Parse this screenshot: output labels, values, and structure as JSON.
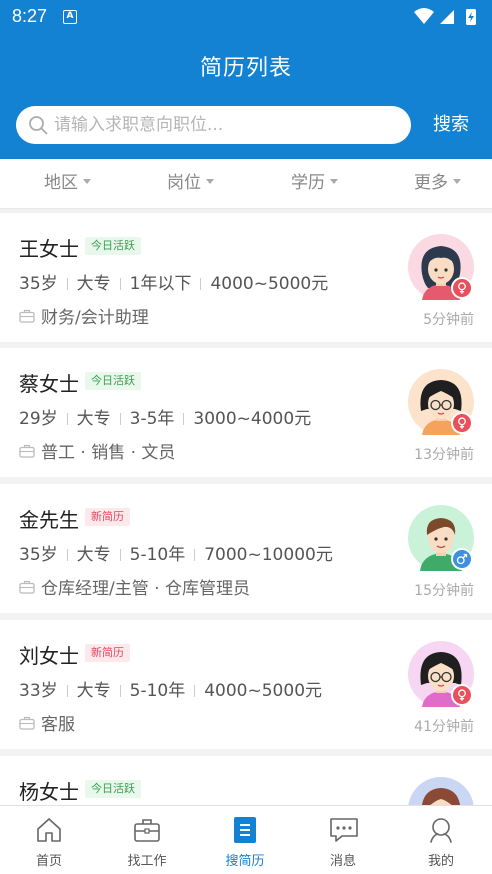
{
  "status_bar": {
    "time": "8:27",
    "app_icon_letter": "A"
  },
  "header": {
    "title": "简历列表"
  },
  "search": {
    "placeholder": "请输入求职意向职位...",
    "button_label": "搜索"
  },
  "filters": [
    {
      "label": "地区"
    },
    {
      "label": "岗位"
    },
    {
      "label": "学历"
    },
    {
      "label": "更多"
    }
  ],
  "resumes": [
    {
      "name": "王女士",
      "badge": "今日活跃",
      "badge_type": "green",
      "age": "35岁",
      "education": "大专",
      "experience": "1年以下",
      "salary": "4000~5000元",
      "jobs": "财务/会计助理",
      "time": "5分钟前",
      "gender": "female",
      "avatar": "woman-dark-hair"
    },
    {
      "name": "蔡女士",
      "badge": "今日活跃",
      "badge_type": "green",
      "age": "29岁",
      "education": "大专",
      "experience": "3-5年",
      "salary": "3000~4000元",
      "jobs": "普工 · 销售 · 文员",
      "time": "13分钟前",
      "gender": "female",
      "avatar": "woman-glasses"
    },
    {
      "name": "金先生",
      "badge": "新简历",
      "badge_type": "red",
      "age": "35岁",
      "education": "大专",
      "experience": "5-10年",
      "salary": "7000~10000元",
      "jobs": "仓库经理/主管 · 仓库管理员",
      "time": "15分钟前",
      "gender": "male",
      "avatar": "man-brown-hair"
    },
    {
      "name": "刘女士",
      "badge": "新简历",
      "badge_type": "red",
      "age": "33岁",
      "education": "大专",
      "experience": "5-10年",
      "salary": "4000~5000元",
      "jobs": "客服",
      "time": "41分钟前",
      "gender": "female",
      "avatar": "woman-glasses-pink"
    },
    {
      "name": "杨女士",
      "badge": "今日活跃",
      "badge_type": "green",
      "gender": "female",
      "avatar": "woman-brown-hair"
    }
  ],
  "tab_bar": {
    "active": "搜简历",
    "items": [
      {
        "label": "首页",
        "icon": "home-icon"
      },
      {
        "label": "找工作",
        "icon": "briefcase-icon"
      },
      {
        "label": "搜简历",
        "icon": "resume-icon"
      },
      {
        "label": "消息",
        "icon": "message-icon"
      },
      {
        "label": "我的",
        "icon": "profile-icon"
      }
    ]
  },
  "colors": {
    "primary": "#1482d2",
    "female": "#e8505b",
    "male": "#3d8fe0"
  }
}
